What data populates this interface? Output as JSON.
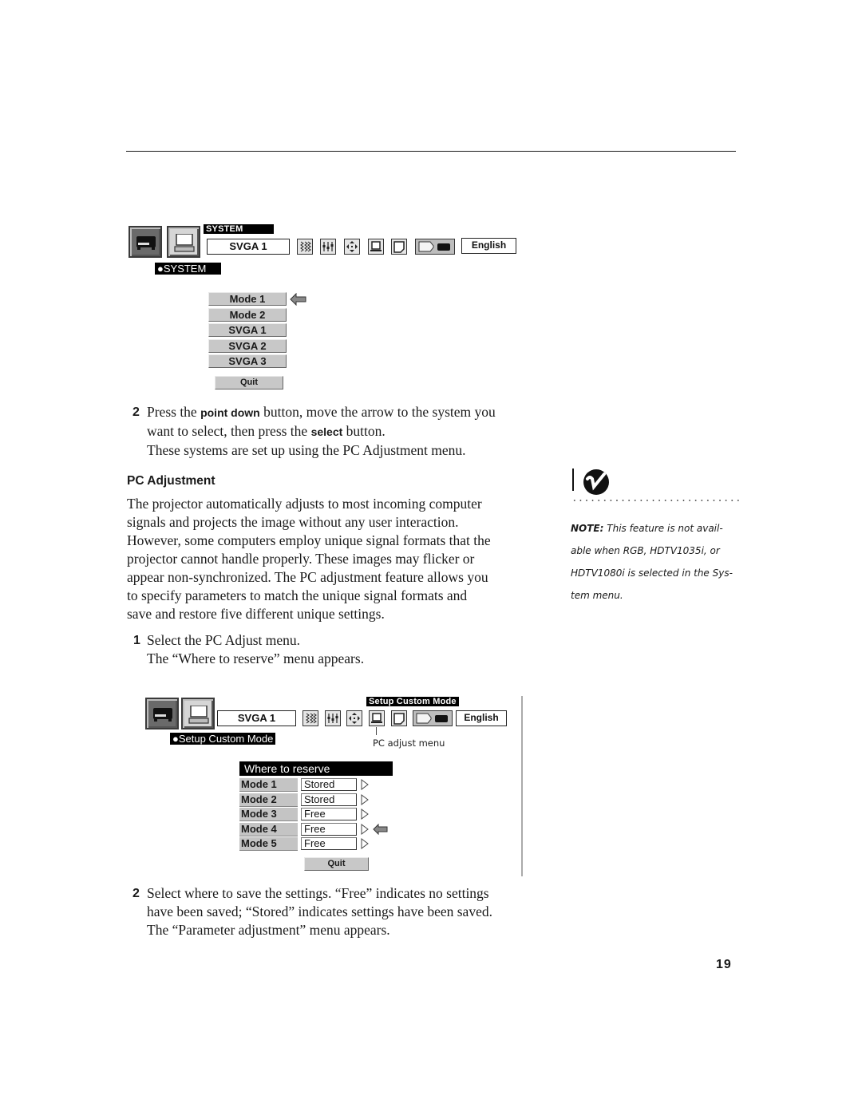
{
  "figure1": {
    "top_label": "SYSTEM",
    "signal_value": "SVGA 1",
    "language_value": "English",
    "section_label": "●SYSTEM",
    "toolbar_icons": [
      "projector-icon",
      "computer-icon",
      "image-adjust-icon",
      "pc-adjust-icon",
      "position-icon",
      "system-icon",
      "screen-icon",
      "keystone-projector-icon"
    ],
    "menu_items": [
      "Mode 1",
      "Mode 2",
      "SVGA 1",
      "SVGA 2",
      "SVGA 3"
    ],
    "selected_index": 0,
    "quit_label": "Quit"
  },
  "step2a": {
    "number": "2",
    "text_before": "Press the ",
    "kbd1": "point down",
    "text_mid": " button, move the arrow to the system you",
    "line2_before": "want to select, then press the ",
    "kbd2": "select",
    "line2_after": " button.",
    "line3": "These systems are set up using the PC Adjustment menu."
  },
  "section": {
    "heading": "PC Adjustment",
    "paragraph": [
      "The projector automatically adjusts to most incoming computer",
      "signals and projects the image without any user interaction.",
      "However, some computers employ unique signal formats that the",
      "projector cannot handle properly. These images may flicker or",
      "appear non-synchronized. The PC adjustment feature allows you",
      "to specify parameters to match the unique signal formats and",
      "save and restore five different unique settings."
    ]
  },
  "step1": {
    "number": "1",
    "line1": "Select the PC Adjust menu.",
    "line2": "The “Where to reserve” menu appears."
  },
  "note": {
    "label": "NOTE:",
    "lines": [
      " This feature is not avail-",
      "able when RGB, HDTV1035i, or",
      "HDTV1080i is selected in the Sys-",
      "tem menu."
    ]
  },
  "figure2": {
    "top_label": "Setup Custom Mode",
    "signal_value": "SVGA 1",
    "language_value": "English",
    "section_label": "●Setup Custom Mode",
    "callout": "PC adjust menu",
    "menu_title": "Where to reserve",
    "rows": [
      {
        "mode": "Mode 1",
        "status": "Stored"
      },
      {
        "mode": "Mode 2",
        "status": "Stored"
      },
      {
        "mode": "Mode 3",
        "status": "Free"
      },
      {
        "mode": "Mode 4",
        "status": "Free"
      },
      {
        "mode": "Mode 5",
        "status": "Free"
      }
    ],
    "selected_index": 3,
    "quit_label": "Quit"
  },
  "step2b": {
    "number": "2",
    "lines": [
      "Select where to save the settings. “Free” indicates no settings",
      "have been saved; “Stored” indicates settings have been saved.",
      "The “Parameter adjustment” menu appears."
    ]
  },
  "page_number": "19"
}
